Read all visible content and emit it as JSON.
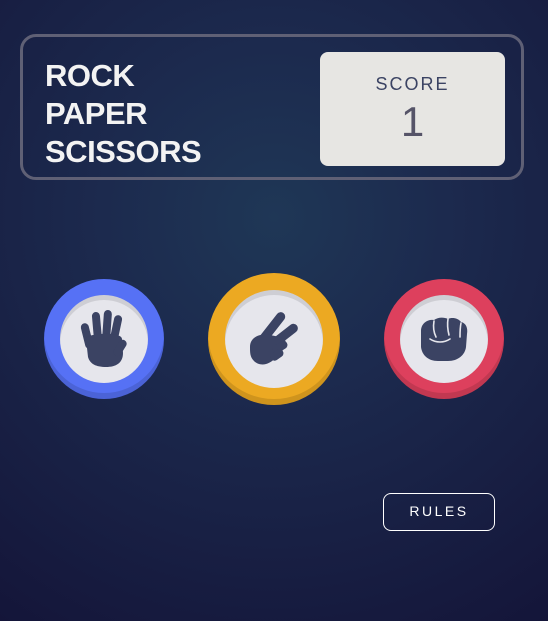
{
  "header": {
    "title_lines": [
      "ROCK",
      "PAPER",
      "SCISSORS"
    ],
    "score_label": "SCORE",
    "score_value": "1"
  },
  "choices": [
    {
      "name": "paper",
      "ring_color": "#5671f5",
      "icon": "paper-hand-icon"
    },
    {
      "name": "scissors",
      "ring_color": "#eca922",
      "icon": "scissors-hand-icon"
    },
    {
      "name": "rock",
      "ring_color": "#dd405d",
      "icon": "rock-fist-icon"
    }
  ],
  "rules_button": {
    "label": "RULES"
  },
  "colors": {
    "background": "#1c2a4e",
    "header_border": "#5f6075",
    "score_box": "#e7e6e3",
    "icon_fill": "#3b4363"
  }
}
